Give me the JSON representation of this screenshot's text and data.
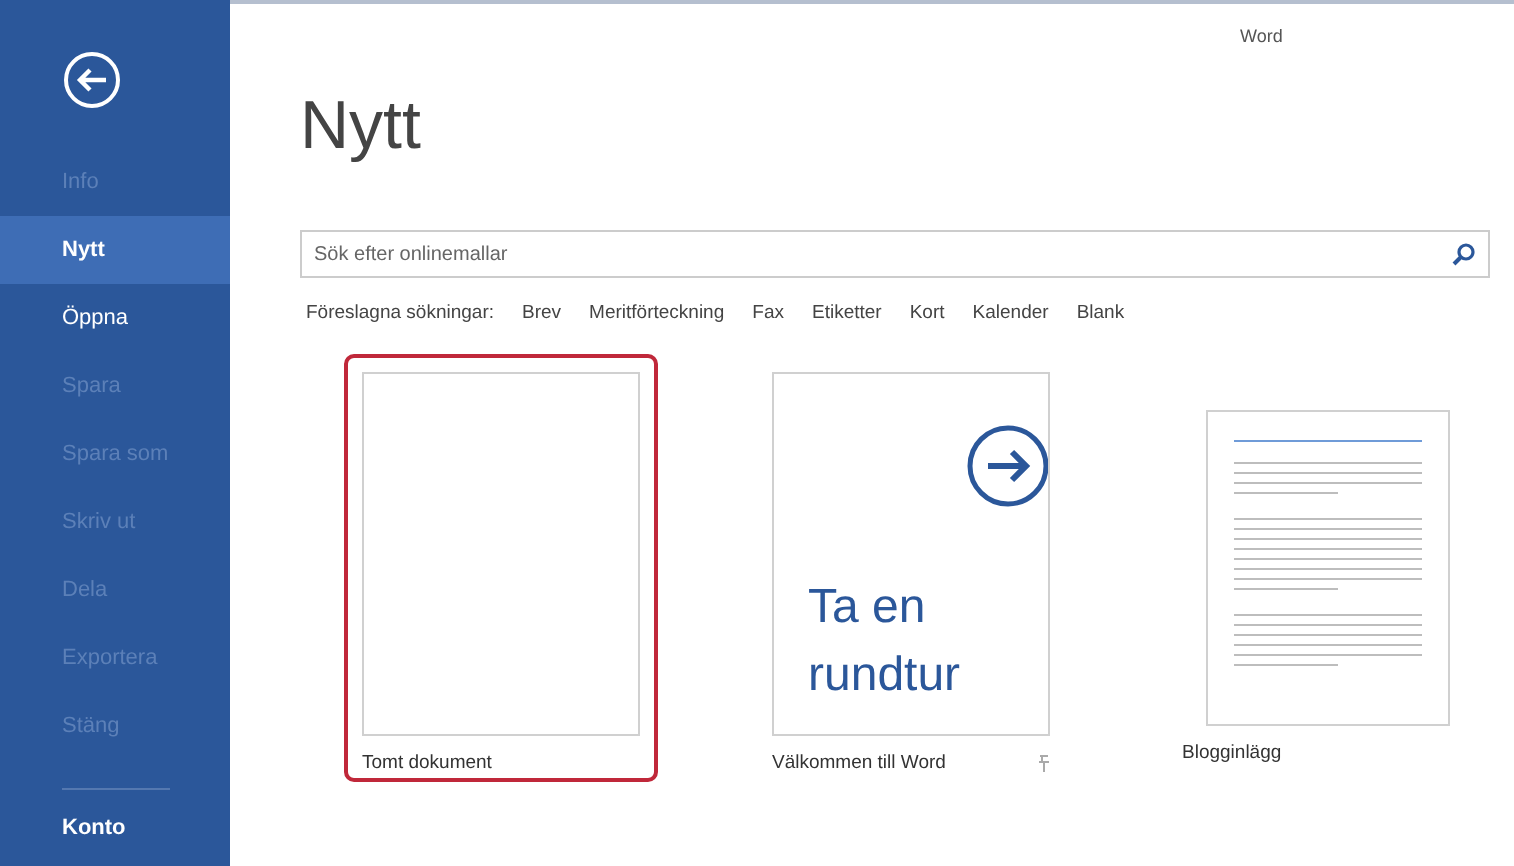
{
  "window": {
    "title": "Word"
  },
  "sidebar": {
    "items": [
      {
        "label": "Info",
        "selected": false,
        "disabled": true
      },
      {
        "label": "Nytt",
        "selected": true,
        "disabled": false
      },
      {
        "label": "Öppna",
        "selected": false,
        "disabled": false
      },
      {
        "label": "Spara",
        "selected": false,
        "disabled": true
      },
      {
        "label": "Spara som",
        "selected": false,
        "disabled": true
      },
      {
        "label": "Skriv ut",
        "selected": false,
        "disabled": true
      },
      {
        "label": "Dela",
        "selected": false,
        "disabled": true
      },
      {
        "label": "Exportera",
        "selected": false,
        "disabled": true
      },
      {
        "label": "Stäng",
        "selected": false,
        "disabled": true
      }
    ],
    "footer": {
      "label": "Konto"
    }
  },
  "heading": "Nytt",
  "search": {
    "placeholder": "Sök efter onlinemallar"
  },
  "suggestions": {
    "label": "Föreslagna sökningar:",
    "links": [
      "Brev",
      "Meritförteckning",
      "Fax",
      "Etiketter",
      "Kort",
      "Kalender",
      "Blank"
    ]
  },
  "templates": [
    {
      "kind": "blank",
      "label": "Tomt dokument",
      "selected": true
    },
    {
      "kind": "tour",
      "label": "Välkommen till Word",
      "tile_text": "Ta en rundtur",
      "selected": false,
      "pinned": true
    },
    {
      "kind": "blog",
      "label": "Blogginlägg",
      "selected": false
    }
  ]
}
